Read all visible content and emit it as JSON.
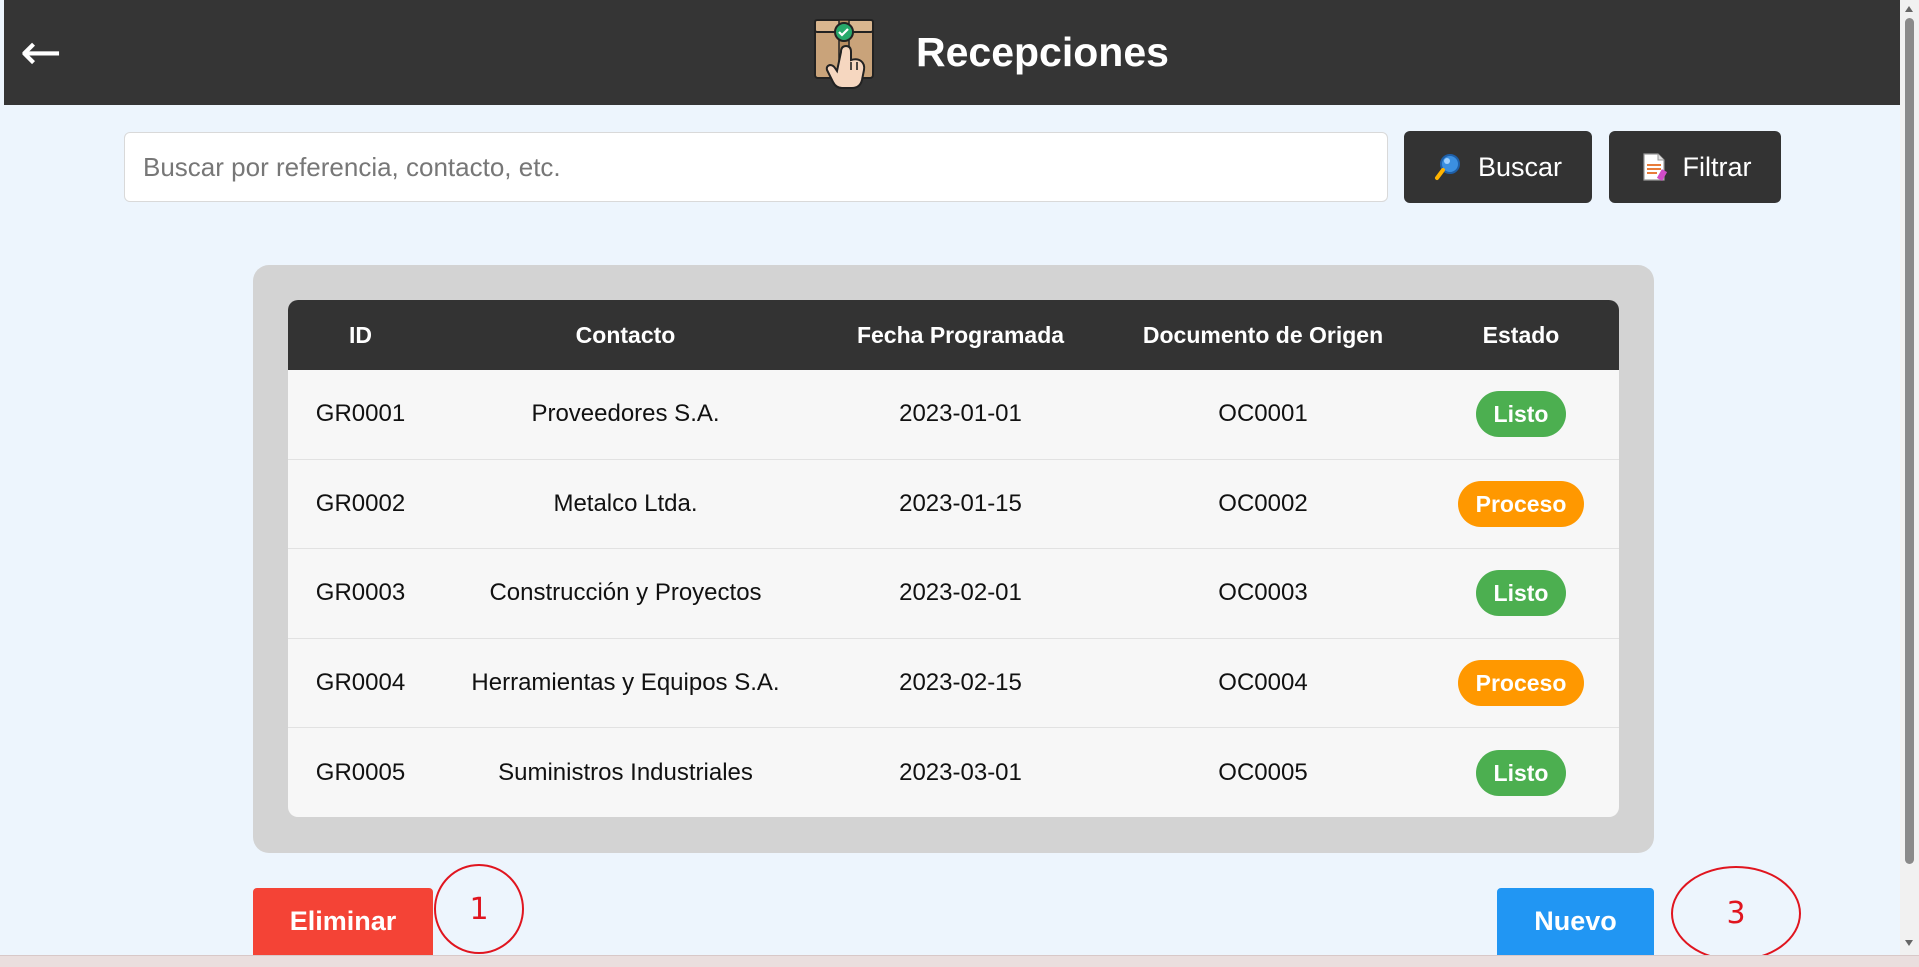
{
  "header": {
    "back_label": "←",
    "title": "Recepciones",
    "logo_icon": "package-hand-icon"
  },
  "search": {
    "placeholder": "Buscar por referencia, contacto, etc.",
    "value": "",
    "search_label": "Buscar",
    "filter_label": "Filtrar"
  },
  "table": {
    "columns": [
      "ID",
      "Contacto",
      "Fecha Programada",
      "Documento de Origen",
      "Estado"
    ],
    "rows": [
      {
        "id": "GR0001",
        "contacto": "Proveedores S.A.",
        "fecha": "2023-01-01",
        "documento": "OC0001",
        "estado": "Listo"
      },
      {
        "id": "GR0002",
        "contacto": "Metalco Ltda.",
        "fecha": "2023-01-15",
        "documento": "OC0002",
        "estado": "Proceso"
      },
      {
        "id": "GR0003",
        "contacto": "Construcción y Proyectos",
        "fecha": "2023-02-01",
        "documento": "OC0003",
        "estado": "Listo"
      },
      {
        "id": "GR0004",
        "contacto": "Herramientas y Equipos S.A.",
        "fecha": "2023-02-15",
        "documento": "OC0004",
        "estado": "Proceso"
      },
      {
        "id": "GR0005",
        "contacto": "Suministros Industriales",
        "fecha": "2023-03-01",
        "documento": "OC0005",
        "estado": "Listo"
      }
    ]
  },
  "actions": {
    "delete_label": "Eliminar",
    "new_label": "Nuevo"
  },
  "annotations": {
    "first": "1",
    "third": "3"
  },
  "colors": {
    "header_bg": "#353535",
    "status_listo": "#4caf50",
    "status_proceso": "#ff9800",
    "delete": "#f44336",
    "new": "#2196f3"
  }
}
